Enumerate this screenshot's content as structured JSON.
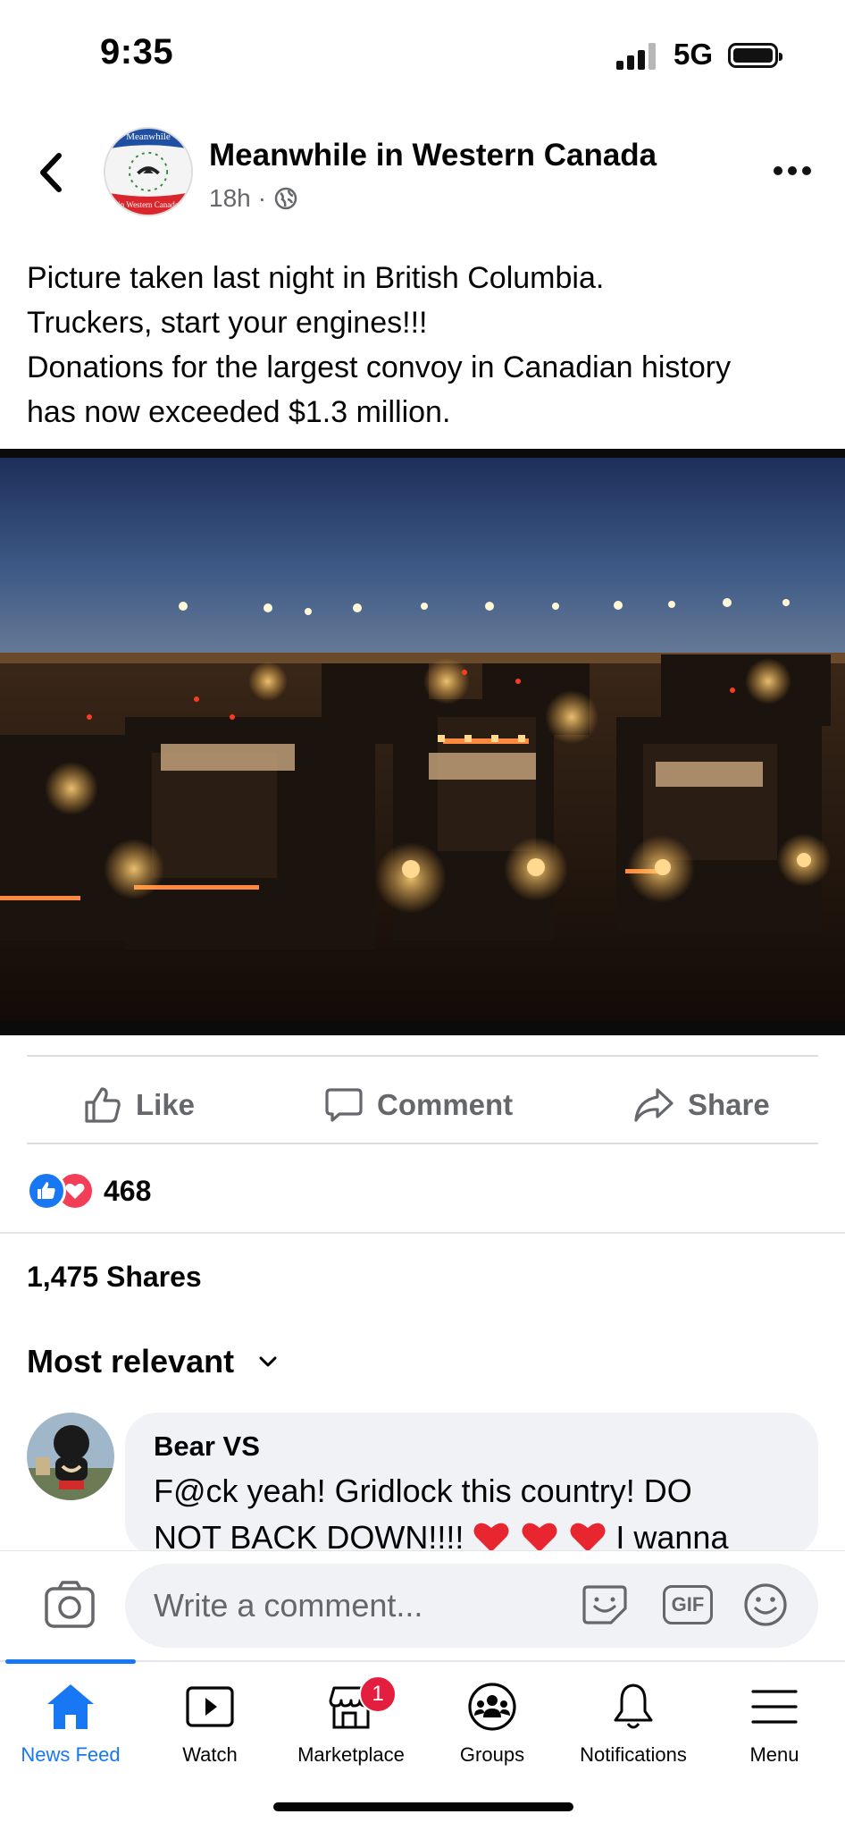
{
  "status_bar": {
    "time": "9:35",
    "network": "5G"
  },
  "post": {
    "page_name": "Meanwhile in Western Canada",
    "avatar_text_top": "Meanwhile",
    "avatar_text_bottom": "in Western Canada",
    "age": "18h",
    "separator": "·",
    "text_lines": [
      "Picture taken last night in British Columbia.",
      "Truckers, start your engines!!!",
      "Donations for the largest convoy in Canadian history",
      "has now exceeded $1.3 million."
    ]
  },
  "actions": {
    "like": "Like",
    "comment": "Comment",
    "share": "Share"
  },
  "reactions": {
    "count": "468"
  },
  "shares": "1,475 Shares",
  "comments": {
    "sort_label": "Most relevant",
    "items": [
      {
        "author": "Bear VS",
        "text_line_1": "F@ck yeah! Gridlock this country! DO",
        "text_line_2_start": "NOT BACK DOWN!!!!",
        "text_line_2_end": "I wanna"
      }
    ]
  },
  "composer": {
    "placeholder": "Write a comment...",
    "gif_label": "GIF"
  },
  "nav": {
    "items": [
      {
        "label": "News Feed",
        "icon": "home-icon",
        "active": true
      },
      {
        "label": "Watch",
        "icon": "watch-icon"
      },
      {
        "label": "Marketplace",
        "icon": "marketplace-icon",
        "badge": "1"
      },
      {
        "label": "Groups",
        "icon": "groups-icon"
      },
      {
        "label": "Notifications",
        "icon": "bell-icon"
      },
      {
        "label": "Menu",
        "icon": "menu-icon"
      }
    ]
  },
  "colors": {
    "accent": "#1877f2",
    "love": "#f33e58",
    "badge": "#e41e3f",
    "secondary_text": "#65676b",
    "bubble": "#f0f2f5"
  }
}
